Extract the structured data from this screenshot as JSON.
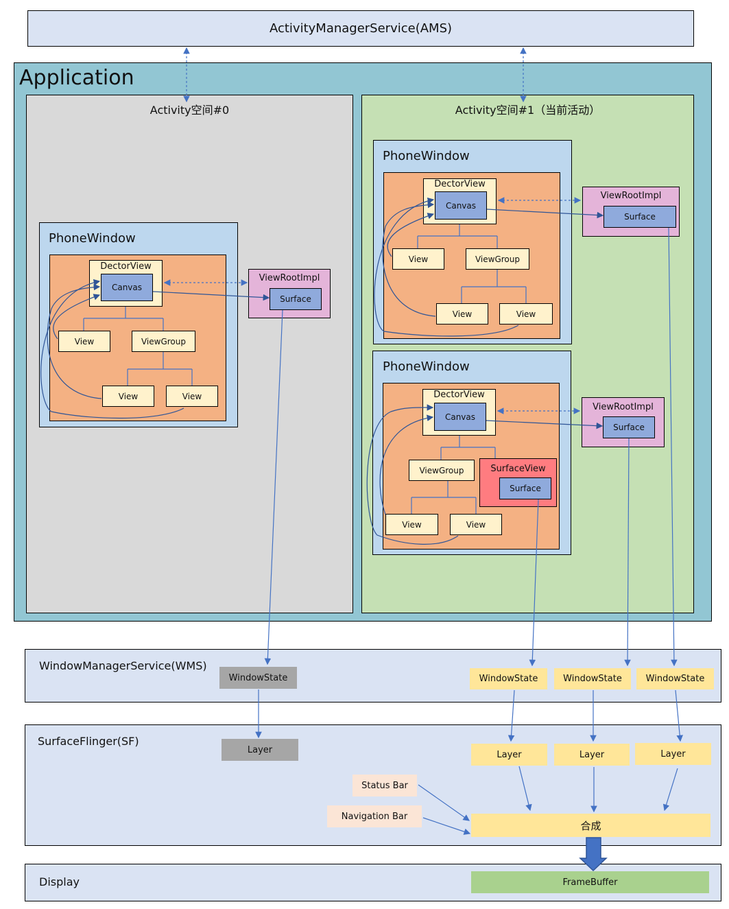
{
  "ams": {
    "label": "ActivityManagerService(AMS)"
  },
  "application": {
    "title": "Application"
  },
  "activity0": {
    "title": "Activity空间#0",
    "window": {
      "title": "PhoneWindow",
      "decor": "DectorView",
      "canvas": "Canvas",
      "view1": "View",
      "viewgroup": "ViewGroup",
      "view2": "View",
      "view3": "View",
      "viewroot": "ViewRootImpl",
      "surface": "Surface"
    }
  },
  "activity1": {
    "title": "Activity空间#1（当前活动）",
    "window1": {
      "title": "PhoneWindow",
      "decor": "DectorView",
      "canvas": "Canvas",
      "view1": "View",
      "viewgroup": "ViewGroup",
      "view2": "View",
      "view3": "View",
      "viewroot": "ViewRootImpl",
      "surface": "Surface"
    },
    "window2": {
      "title": "PhoneWindow",
      "decor": "DectorView",
      "canvas": "Canvas",
      "viewgroup": "ViewGroup",
      "surfaceview": "SurfaceView",
      "sv_surface": "Surface",
      "view1": "View",
      "view2": "View",
      "viewroot": "ViewRootImpl",
      "surface": "Surface"
    }
  },
  "wms": {
    "title": "WindowManagerService(WMS)",
    "states": [
      "WindowState",
      "WindowState",
      "WindowState",
      "WindowState"
    ]
  },
  "sf": {
    "title": "SurfaceFlinger(SF)",
    "layers": [
      "Layer",
      "Layer",
      "Layer",
      "Layer"
    ],
    "status_bar": "Status Bar",
    "navigation_bar": "Navigation Bar",
    "compose": "合成"
  },
  "display": {
    "title": "Display",
    "framebuffer": "FrameBuffer"
  },
  "colors": {
    "service": "#dae3f3",
    "application": "#92c6d3",
    "activity0": "#d9d9d9",
    "activity1": "#c5e0b4",
    "phonewindow": "#bdd7ee",
    "decor_area": "#f4b183",
    "view": "#fff2cc",
    "canvas": "#8faadc",
    "viewroot": "#e4b4d9",
    "surfaceview": "#ff7c80",
    "inactive": "#a6a6a6",
    "active": "#ffe699",
    "bar": "#fbe5d6",
    "framebuffer": "#a9d18e",
    "arrow": "#4472c4"
  }
}
